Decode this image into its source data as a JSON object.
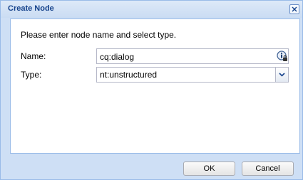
{
  "dialog": {
    "title": "Create Node",
    "instruction": "Please enter node name and select type.",
    "name_label": "Name:",
    "name_value": "cq:dialog",
    "type_label": "Type:",
    "type_value": "nt:unstructured",
    "ok_label": "OK",
    "cancel_label": "Cancel"
  },
  "icons": {
    "close": "close-icon",
    "info": "info-lock-icon",
    "dropdown": "chevron-down-icon"
  },
  "colors": {
    "title_text": "#15428b",
    "window_border": "#99bbe8",
    "window_bg": "#cedff5"
  }
}
